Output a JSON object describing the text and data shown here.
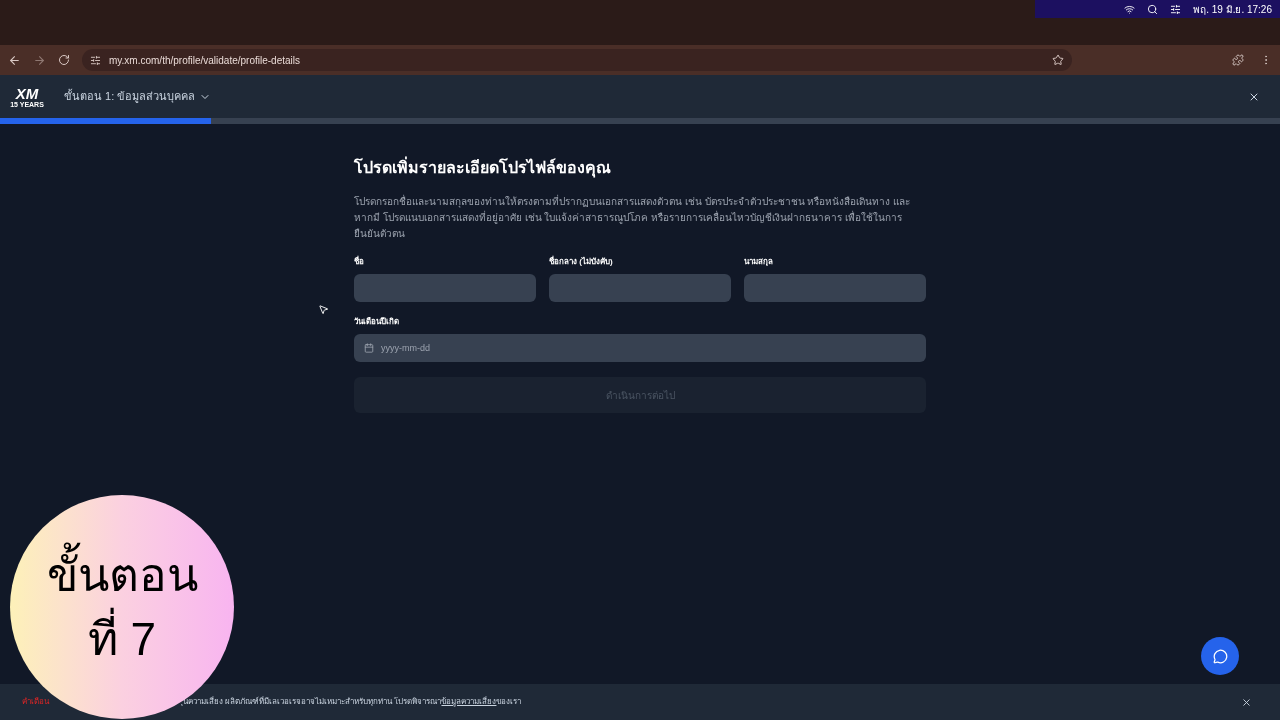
{
  "menubar": {
    "clock": "พฤ. 19 มิ.ย. 17:26"
  },
  "browser": {
    "url": "my.xm.com/th/profile/validate/profile-details"
  },
  "header": {
    "logo_text": "XM",
    "logo_sub": "15 YEARS",
    "step": "ขั้นตอน 1: ข้อมูลส่วนบุคคล",
    "progress": {
      "level": 0.165
    }
  },
  "form": {
    "title": "โปรดเพิ่มรายละเอียดโปรไฟล์ของคุณ",
    "description": "โปรดกรอกชื่อและนามสกุลของท่านให้ตรงตามที่ปรากฏบนเอกสารแสดงตัวตน เช่น บัตรประจำตัวประชาชน หรือหนังสือเดินทาง และหากมี โปรดแนบเอกสารแสดงที่อยู่อาศัย เช่น ใบแจ้งค่าสาธารณูปโภค หรือรายการเคลื่อนไหวบัญชีเงินฝากธนาคาร เพื่อใช้ในการยืนยันตัวตน",
    "name_fields": [
      {
        "label": "ชื่อ"
      },
      {
        "label": "ชื่อกลาง (ไม่บังคับ)"
      },
      {
        "label": "นามสกุล"
      }
    ],
    "birth_date": {
      "label": "วันเดือนปีเกิด",
      "placeholder": "yyyy-mm-dd"
    },
    "submit": {
      "label": "ดำเนินการต่อไป",
      "disabled": true
    }
  },
  "risk_banner": {
    "label": "คำเตือน",
    "text": "ุนความเสี่ยง ผลิตภัณฑ์ที่มีเลเวอเรจอาจไม่เหมาะสำหรับทุกท่าน โปรดพิจารณา",
    "link": "ข้อมูลความเสี่ยง",
    "text_after": "ของเรา"
  },
  "overlay": {
    "line1": "ขั้นตอน",
    "line2": "ที่ 7"
  }
}
